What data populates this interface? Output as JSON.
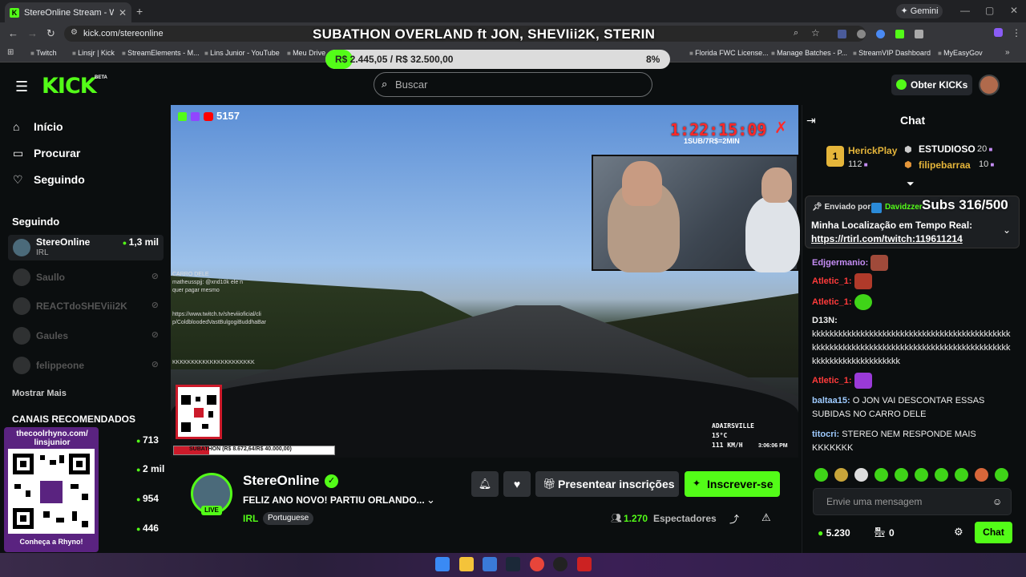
{
  "browser": {
    "tab_title": "StereOnline Stream - Watch",
    "tab_close": "✕",
    "new_tab": "+",
    "gemini": "✦ Gemini",
    "url": "kick.com/stereonline",
    "bookmarks": [
      "Twitch",
      "Linsjr | Kick",
      "StreamElements - M...",
      "Lins Junior - YouTube",
      "Meu Drive",
      "Florida FWC License...",
      "Manage Batches - P...",
      "StreamVIP Dashboard",
      "MyEasyGov"
    ]
  },
  "overlay": {
    "title": "SUBATHON OVERLAND ft JON, SHEVIii2K, STERIN",
    "goal_text": "R$ 2.445,05 / R$ 32.500,00",
    "goal_pct_text": "8%",
    "goal_fraction": 0.08
  },
  "header": {
    "logo": "KICK",
    "logo_badge": "BETA",
    "search_placeholder": "Buscar",
    "get_kicks": "Obter KICKs"
  },
  "sidebar": {
    "nav": [
      {
        "label": "Início",
        "icon": "home-icon"
      },
      {
        "label": "Procurar",
        "icon": "browse-icon"
      },
      {
        "label": "Seguindo",
        "icon": "heart-icon"
      }
    ],
    "following_heading": "Seguindo",
    "following": [
      {
        "name": "StereOnline",
        "category": "IRL",
        "viewers": "1,3 mil",
        "live": true
      },
      {
        "name": "Saullo",
        "live": false
      },
      {
        "name": "REACTdoSHEViii2K",
        "live": false
      },
      {
        "name": "Gaules",
        "live": false
      },
      {
        "name": "felippeone",
        "live": false
      }
    ],
    "show_more": "Mostrar Mais",
    "recommended_heading": "CANAIS RECOMENDADOS",
    "recommended_viewers": [
      "713",
      "2 mil",
      "954",
      "446"
    ],
    "promo_url": "thecoolrhyno.com/ linsjunior",
    "promo_cta": "Conheça a Rhyno!"
  },
  "video": {
    "viewer_count_overlay": "5157",
    "timer": "1:22:15:09",
    "timer_sub": "1SUB/7R$=2MIN",
    "subbar_text": "SUBATHON (R$ 8.672,64/R$ 40.000,00)",
    "subbar_fraction": 0.22,
    "location": [
      "ADAIRSVILLE",
      "15°C",
      "111 KM/H"
    ],
    "clock": "3:06:06 PM",
    "chat_overlay": [
      "CARRO DELE",
      "matheusspjj: @xnd10k ele n",
      "quer pagar mesmo",
      "https://www.twitch.tv/sheviiioficial/cli",
      "p/ColdbloodedVastBulgogiBuddhaBar",
      "KKKKKKKKKKKKKKKKKKKKKK"
    ]
  },
  "stream": {
    "streamer": "StereOnline",
    "live_label": "LIVE",
    "title": "FELIZ ANO NOVO! PARTIU ORLANDO...",
    "category": "IRL",
    "language": "Portuguese",
    "gift_label": "Presentear inscrições",
    "subscribe_label": "Inscrever-se",
    "viewers": "1.270",
    "viewers_label": "Espectadores"
  },
  "chat": {
    "title": "Chat",
    "leaderboard": [
      {
        "rank": "1",
        "name": "HerickPlay",
        "value": "112"
      },
      {
        "name": "ESTUDIOSO",
        "value": "20"
      },
      {
        "name": "filipebarraa",
        "value": "10"
      }
    ],
    "pinned_sender_label": "Enviado por",
    "pinned_sender": "Davidzzer",
    "subs_overlay": "Subs 316/500",
    "pinned_message": "Minha Localização em Tempo Real:",
    "pinned_link": "https://rtirl.com/twitch:119611214",
    "messages": [
      {
        "user": "Edjgermanio:",
        "text": "",
        "color": "#c58df5"
      },
      {
        "user": "Atletic_1:",
        "text": "",
        "color": "#ff3b3b"
      },
      {
        "user": "Atletic_1:",
        "text": "",
        "color": "#ff3b3b"
      },
      {
        "user": "D13N:",
        "text": "kkkkkkkkkkkkkkkkkkkkkkkkkkkkkkkkkkkkkkkkkkkkkkkkkkkkkkkkkkkkkkkkkkkkkkkkkkkkkkkkkkkkkkkkkkkkkkkkkkkkkkkkkkkkkk",
        "color": "#ffffff"
      },
      {
        "user": "Atletic_1:",
        "text": "",
        "color": "#ff3b3b"
      },
      {
        "user": "baltaa15:",
        "text": "O JON VAI DESCONTAR ESSAS SUBIDAS NO CARRO DELE",
        "color": "#9ecbff"
      },
      {
        "user": "titocri:",
        "text": "STEREO NEM RESPONDE MAIS KKKKKKK",
        "color": "#9ecbff"
      }
    ],
    "input_placeholder": "Envie uma mensagem",
    "points": "5.230",
    "store_count": "0",
    "send_label": "Chat"
  }
}
